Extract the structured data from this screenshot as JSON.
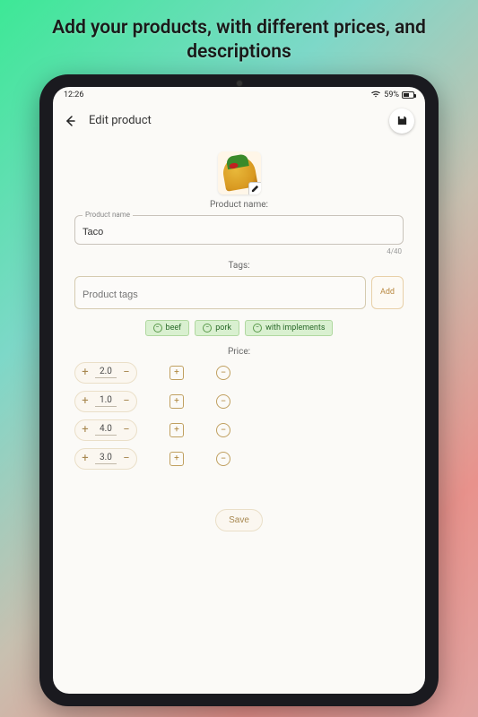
{
  "promo": "Add your products, with different prices, and descriptions",
  "statusbar": {
    "time": "12:26",
    "battery_pct": "59%"
  },
  "appbar": {
    "title": "Edit product"
  },
  "section_labels": {
    "product_name": "Product name:",
    "tags": "Tags:",
    "price": "Price:"
  },
  "product_name": {
    "float_label": "Product name",
    "value": "Taco",
    "counter": "4/40"
  },
  "tags": {
    "placeholder": "Product tags",
    "add_label": "Add",
    "items": [
      "beef",
      "pork",
      "with implements"
    ]
  },
  "prices": [
    {
      "value": "2.0"
    },
    {
      "value": "1.0"
    },
    {
      "value": "4.0"
    },
    {
      "value": "3.0"
    }
  ],
  "save_label": "Save"
}
